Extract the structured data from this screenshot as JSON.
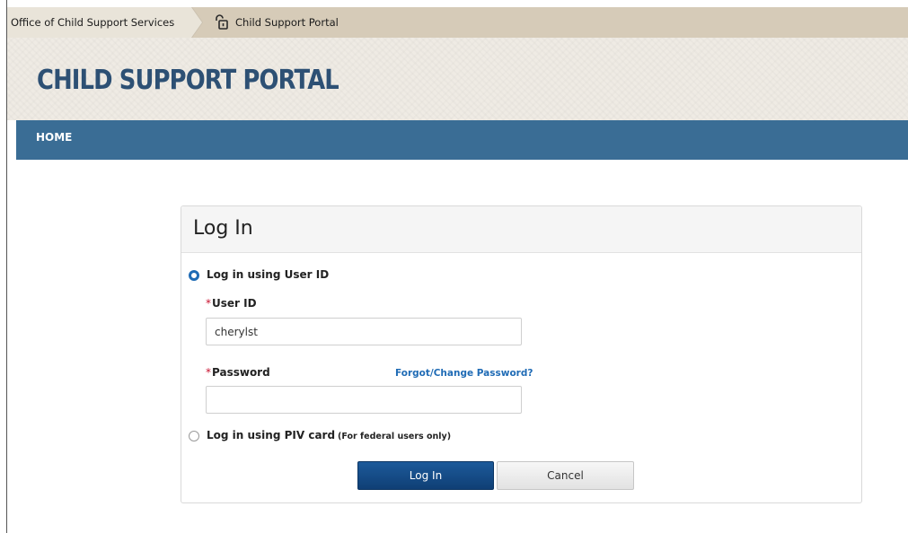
{
  "breadcrumb": {
    "items": [
      {
        "label": "Office of Child Support Services"
      },
      {
        "label": "Child Support Portal",
        "icon": "lock-icon"
      }
    ]
  },
  "header": {
    "title": "CHILD SUPPORT PORTAL"
  },
  "nav": {
    "items": [
      {
        "label": "HOME"
      }
    ]
  },
  "login": {
    "title": "Log In",
    "option_userid": {
      "label": "Log in using User ID",
      "selected": true
    },
    "userid": {
      "required_mark": "*",
      "label": "User ID",
      "value": "cherylst",
      "placeholder": ""
    },
    "password": {
      "required_mark": "*",
      "label": "Password",
      "value": "",
      "placeholder": ""
    },
    "forgot_link": "Forgot/Change Password?",
    "option_piv": {
      "label": "Log in using PIV card",
      "note": "(For federal users only)",
      "selected": false
    },
    "buttons": {
      "login": "Log In",
      "cancel": "Cancel"
    }
  },
  "colors": {
    "title": "#2d5074",
    "nav_bar": "#3a6d95",
    "link": "#1f6bb5",
    "primary_button": "#1d5a9a",
    "required": "#c8102e",
    "breadcrumb_bg": "#d6cbb8"
  }
}
